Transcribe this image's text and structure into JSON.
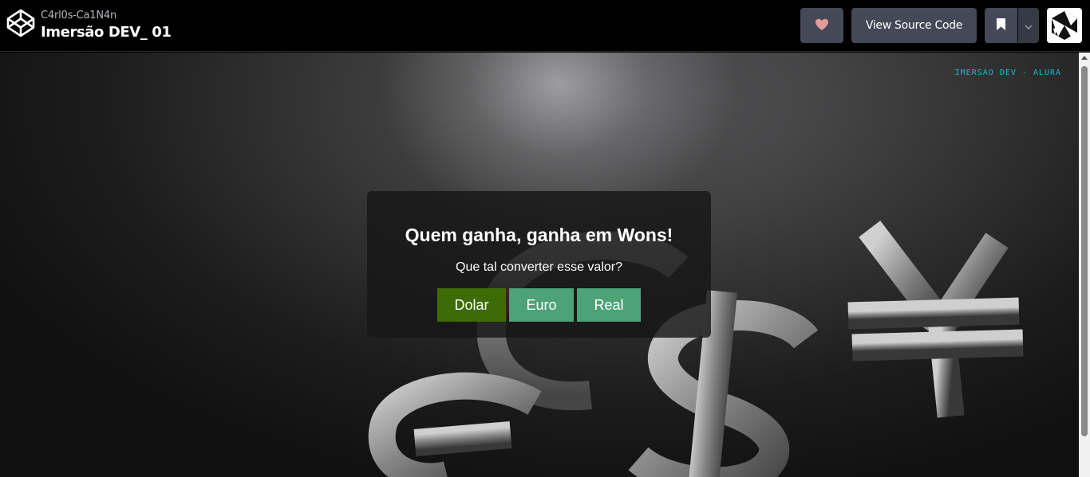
{
  "header": {
    "author": "C4rl0s-Ca1N4n",
    "title": "Imersão DEV_ 01",
    "view_source_label": "View Source Code",
    "icons": {
      "logo": "codepen-logo-icon",
      "heart": "heart-icon",
      "bookmark": "bookmark-icon",
      "caret": "chevron-down-icon",
      "avatar": "user-avatar"
    },
    "heart_color": "#e39c9a"
  },
  "preview": {
    "tagline": "Imersao Dev - Alura",
    "heading": "Quem ganha, ganha em Wons!",
    "subtext": "Que tal converter esse valor?",
    "buttons": {
      "dolar": "Dolar",
      "euro": "Euro",
      "real": "Real"
    },
    "colors": {
      "dolar_button": "#3d6b06",
      "other_buttons": "#4da277",
      "tagline": "#21b6c9"
    }
  }
}
